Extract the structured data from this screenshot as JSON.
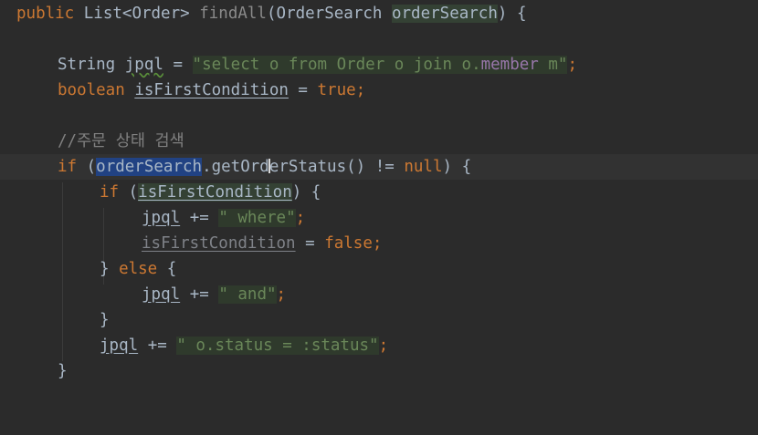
{
  "editor": {
    "lines": {
      "l1": {
        "kw_public": "public",
        "type": "List<Order>",
        "method": "findAll",
        "open": "(",
        "param_type": "OrderSearch",
        "param_name": "orderSearch",
        "close": ") {"
      },
      "l2": {
        "type": "String",
        "var": "jpql",
        "eq": " = ",
        "str_a": "\"select o from Order o join o.",
        "str_field": "member",
        "str_b": " m\"",
        "semi": ";"
      },
      "l3": {
        "kw_boolean": "boolean",
        "var": "isFirstCondition",
        "eq": " = ",
        "kw_true": "true",
        "semi": ";"
      },
      "l4": {
        "comment": "//주문 상태 검색"
      },
      "l5": {
        "kw_if": "if",
        "open": " (",
        "selected": "orderSearch",
        "call_a": ".getOrd",
        "call_b": "erStatus() != ",
        "kw_null": "null",
        "close": ") {"
      },
      "l6": {
        "kw_if": "if",
        "open": " (",
        "var": "isFirstCondition",
        "close": ") {"
      },
      "l7": {
        "var": "jpql",
        "op": " += ",
        "str": "\" where\"",
        "semi": ";"
      },
      "l8": {
        "var": "isFirstCondition",
        "eq": " = ",
        "kw_false": "false",
        "semi": ";"
      },
      "l9": {
        "brace": "} ",
        "kw_else": "else",
        "open": " {"
      },
      "l10": {
        "var": "jpql",
        "op": " += ",
        "str": "\" and\"",
        "semi": ";"
      },
      "l11": {
        "brace": "}"
      },
      "l12": {
        "var": "jpql",
        "op": " += ",
        "str": "\" o.status = :status\"",
        "semi": ";"
      },
      "l13": {
        "brace": "}"
      }
    },
    "colors": {
      "background": "#2b2b2b",
      "keyword": "#cc7832",
      "string": "#6a8759",
      "field": "#9876aa",
      "comment": "#808080",
      "selection": "#214283"
    }
  }
}
